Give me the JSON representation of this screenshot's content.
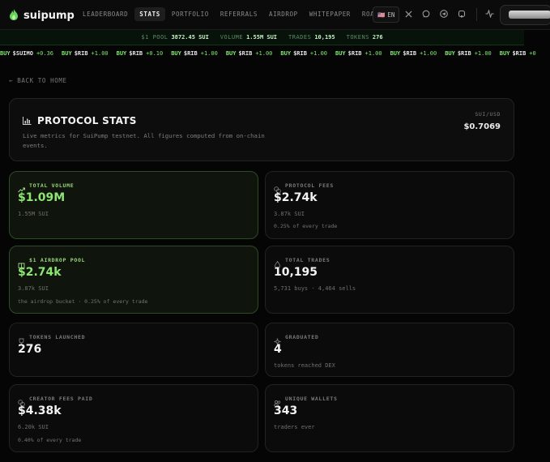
{
  "brand": {
    "name": "suipump"
  },
  "nav": [
    "LEADERBOARD",
    "STATS",
    "PORTFOLIO",
    "REFERRALS",
    "AIRDROP",
    "WHITEPAPER",
    "ROADMAP"
  ],
  "nav_active": "STATS",
  "lang": {
    "flag": "🇺🇸",
    "label": "EN"
  },
  "statsbar": {
    "pool_label": "$1 POOL",
    "pool_value": "3872.45 SUI",
    "volume_label": "VOLUME",
    "volume_value": "1.55M SUI",
    "trades_label": "TRADES",
    "trades_value": "10,195",
    "tokens_label": "TOKENS",
    "tokens_value": "276"
  },
  "ticker": [
    {
      "side": "BUY",
      "symbol": "$SUIMO",
      "change": "+0.36"
    },
    {
      "side": "BUY",
      "symbol": "$RIB",
      "change": "+1.00"
    },
    {
      "side": "BUY",
      "symbol": "$RIB",
      "change": "+0.10"
    },
    {
      "side": "BUY",
      "symbol": "$RIB",
      "change": "+1.00"
    },
    {
      "side": "BUY",
      "symbol": "$RIB",
      "change": "+1.00"
    },
    {
      "side": "BUY",
      "symbol": "$RIB",
      "change": "+1.00"
    },
    {
      "side": "BUY",
      "symbol": "$RIB",
      "change": "+1.00"
    },
    {
      "side": "BUY",
      "symbol": "$RIB",
      "change": "+1.00"
    },
    {
      "side": "BUY",
      "symbol": "$RIB",
      "change": "+1.00"
    },
    {
      "side": "BUY",
      "symbol": "$RIB",
      "change": "+0"
    }
  ],
  "back_label": "← BACK TO HOME",
  "header": {
    "title": "PROTOCOL STATS",
    "subtitle": "Live metrics for SuiPump testnet. All figures computed from on-chain events.",
    "price_label": "SUI/USD",
    "price_value": "$0.7069"
  },
  "cards": {
    "total_volume": {
      "label": "TOTAL VOLUME",
      "value": "$1.09M",
      "sub": "1.55M SUI"
    },
    "protocol_fees": {
      "label": "PROTOCOL FEES",
      "value": "$2.74k",
      "sub": "3.87k SUI",
      "note": "0.25% of every trade"
    },
    "airdrop_pool": {
      "label": "$1 AIRDROP POOL",
      "value": "$2.74k",
      "sub": "3.87k SUI",
      "note": "the airdrop bucket · 0.25% of every trade"
    },
    "total_trades": {
      "label": "TOTAL TRADES",
      "value": "10,195",
      "sub": "5,731 buys · 4,464 sells"
    },
    "tokens_launched": {
      "label": "TOKENS LAUNCHED",
      "value": "276"
    },
    "graduated": {
      "label": "GRADUATED",
      "value": "4",
      "sub": "tokens reached DEX"
    },
    "creator_fees": {
      "label": "CREATOR FEES PAID",
      "value": "$4.38k",
      "sub": "6.20k SUI",
      "note": "0.40% of every trade"
    },
    "unique_wallets": {
      "label": "UNIQUE WALLETS",
      "value": "343",
      "sub": "traders ever"
    }
  },
  "colors": {
    "accent": "#8ee672",
    "bg": "#050505",
    "card": "#0b0b0b",
    "highlight_card": "#0f150c"
  },
  "icons": {
    "brand": "flame-icon",
    "x": "x-icon",
    "chat": "chat-icon",
    "telegram": "telegram-icon",
    "github": "github-icon",
    "activity": "activity-icon"
  }
}
